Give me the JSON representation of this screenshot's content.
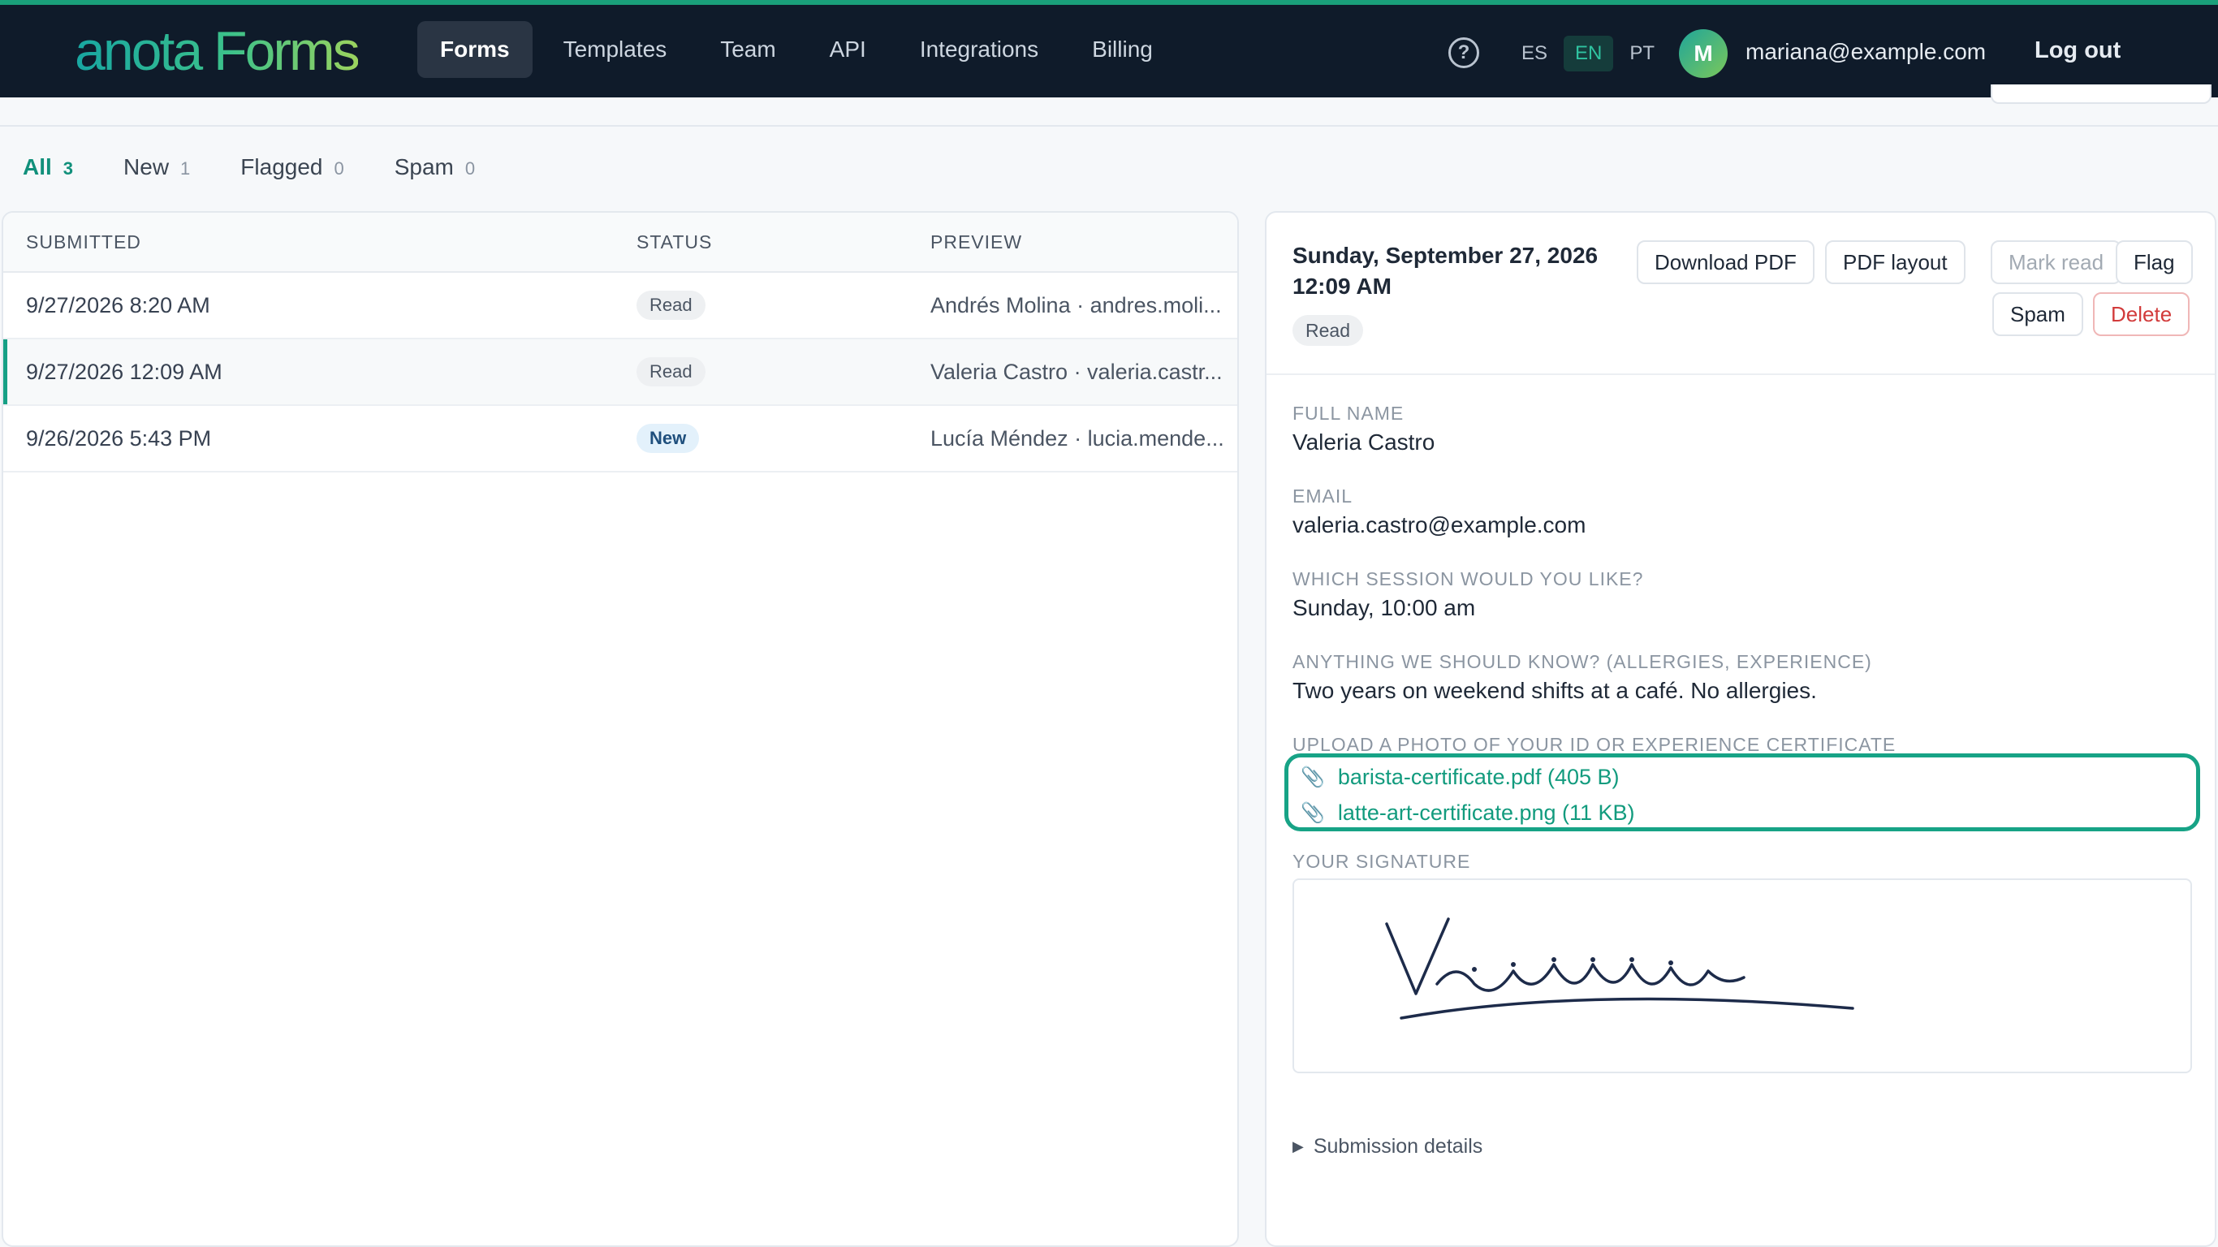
{
  "brand": "anota Forms",
  "nav": [
    {
      "label": "Forms",
      "active": true
    },
    {
      "label": "Templates"
    },
    {
      "label": "Team"
    },
    {
      "label": "API"
    },
    {
      "label": "Integrations"
    },
    {
      "label": "Billing"
    }
  ],
  "help_icon": "?",
  "languages": [
    {
      "code": "ES"
    },
    {
      "code": "EN",
      "active": true
    },
    {
      "code": "PT"
    }
  ],
  "user": {
    "initial": "M",
    "email": "mariana@example.com"
  },
  "logout_label": "Log out",
  "filters": [
    {
      "label": "All",
      "count": "3",
      "active": true
    },
    {
      "label": "New",
      "count": "1"
    },
    {
      "label": "Flagged",
      "count": "0"
    },
    {
      "label": "Spam",
      "count": "0"
    }
  ],
  "list": {
    "columns": {
      "submitted": "SUBMITTED",
      "status": "STATUS",
      "preview": "PREVIEW"
    },
    "rows": [
      {
        "submitted": "9/27/2026 8:20 AM",
        "status": "Read",
        "preview": "Andrés Molina · andres.moli..."
      },
      {
        "submitted": "9/27/2026 12:09 AM",
        "status": "Read",
        "preview": "Valeria Castro · valeria.castr...",
        "selected": true
      },
      {
        "submitted": "9/26/2026 5:43 PM",
        "status": "New",
        "preview": "Lucía Méndez · lucia.mende..."
      }
    ]
  },
  "detail": {
    "date_line1": "Sunday, September 27, 2026",
    "date_line2": "12:09 AM",
    "status": "Read",
    "buttons": {
      "download_pdf": "Download PDF",
      "pdf_layout": "PDF layout",
      "mark_read": "Mark read",
      "flag": "Flag",
      "spam": "Spam",
      "delete": "Delete"
    },
    "fields": [
      {
        "label": "FULL NAME",
        "value": "Valeria Castro"
      },
      {
        "label": "EMAIL",
        "value": "valeria.castro@example.com"
      },
      {
        "label": "WHICH SESSION WOULD YOU LIKE?",
        "value": "Sunday, 10:00 am"
      },
      {
        "label": "ANYTHING WE SHOULD KNOW? (ALLERGIES, EXPERIENCE)",
        "value": "Two years on weekend shifts at a café. No allergies."
      }
    ],
    "upload_label": "UPLOAD A PHOTO OF YOUR ID OR EXPERIENCE CERTIFICATE",
    "attachments": [
      {
        "name": "barista-certificate.pdf (405 B)"
      },
      {
        "name": "latte-art-certificate.png (11 KB)"
      }
    ],
    "signature_label": "YOUR SIGNATURE",
    "submission_details": "Submission details"
  },
  "colors": {
    "accent": "#16a085",
    "topbar": "#0f1b2a",
    "danger": "#d23b3b"
  }
}
